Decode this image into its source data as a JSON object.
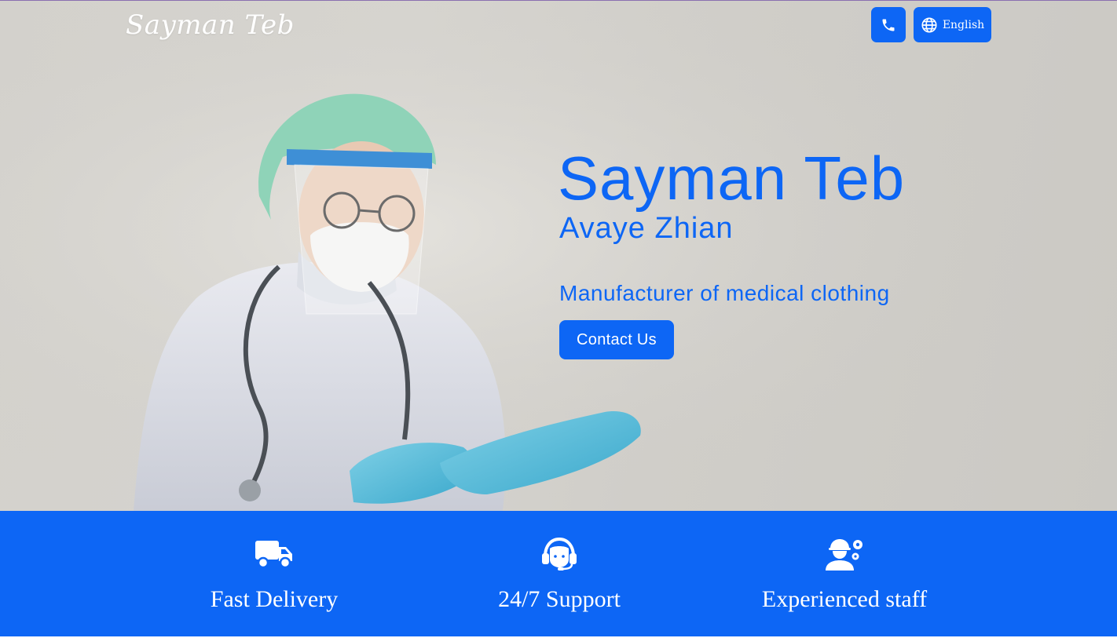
{
  "header": {
    "logo_text": "Sayman Teb",
    "phone_icon": "phone-icon",
    "language_icon": "globe-icon",
    "language_label": "English"
  },
  "hero": {
    "title": "Sayman Teb",
    "subtitle": "Avaye Zhian",
    "tagline": "Manufacturer of medical clothing",
    "cta_label": "Contact Us",
    "image": "doctor-in-ppe-photo"
  },
  "features": [
    {
      "icon": "truck-icon",
      "label": "Fast Delivery"
    },
    {
      "icon": "headset-icon",
      "label": "24/7 Support"
    },
    {
      "icon": "worker-gears-icon",
      "label": "Experienced staff"
    }
  ],
  "colors": {
    "brand_blue": "#0d66f5",
    "hero_background": "#d3d1cc",
    "white": "#ffffff"
  }
}
